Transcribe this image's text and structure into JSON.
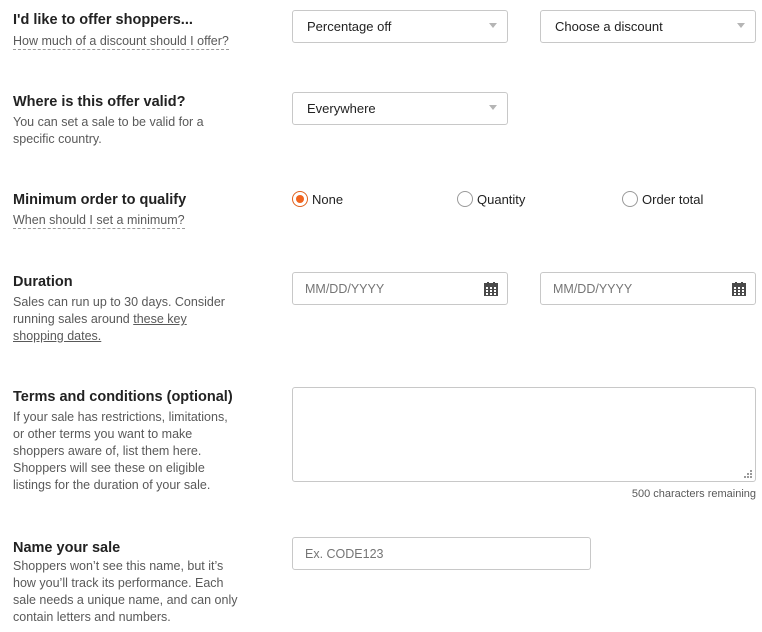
{
  "offer": {
    "title": "I'd like to offer shoppers...",
    "help": "How much of a discount should I offer?",
    "type_select": "Percentage off",
    "discount_select": "Choose a discount"
  },
  "valid": {
    "title": "Where is this offer valid?",
    "desc_line1": "You can set a sale to be valid for a",
    "desc_line2": "specific country.",
    "location_select": "Everywhere"
  },
  "minimum": {
    "title": "Minimum order to qualify",
    "help": "When should I set a minimum?",
    "options": [
      "None",
      "Quantity",
      "Order total"
    ],
    "selected": "None"
  },
  "duration": {
    "title": "Duration",
    "desc_line1": "Sales can run up to 30 days. Consider",
    "desc_line2_prefix": "running sales around",
    "desc_link_part1": "these key",
    "desc_link_part2": "shopping dates.",
    "start_placeholder": "MM/DD/YYYY",
    "end_placeholder": "MM/DD/YYYY"
  },
  "terms": {
    "title": "Terms and conditions (optional)",
    "desc_lines": [
      "If your sale has restrictions, limitations,",
      "or other terms you want to make",
      "shoppers aware of, list them here.",
      "Shoppers will see these on eligible",
      "listings for the duration of your sale."
    ],
    "value": "",
    "remaining": "500 characters remaining"
  },
  "name": {
    "title": "Name your sale",
    "desc_lines": [
      "Shoppers won’t see this name, but it’s",
      "how you’ll track its performance. Each",
      "sale needs a unique name, and can only",
      "contain letters and numbers."
    ],
    "placeholder": "Ex. CODE123"
  },
  "colors": {
    "accent": "#f1641e",
    "text": "#222222",
    "muted": "#595959",
    "border": "#c8c8c8"
  },
  "icons": {
    "select_caret": "caret-down-icon",
    "date_picker": "calendar-icon",
    "resize": "resize-handle-icon"
  }
}
